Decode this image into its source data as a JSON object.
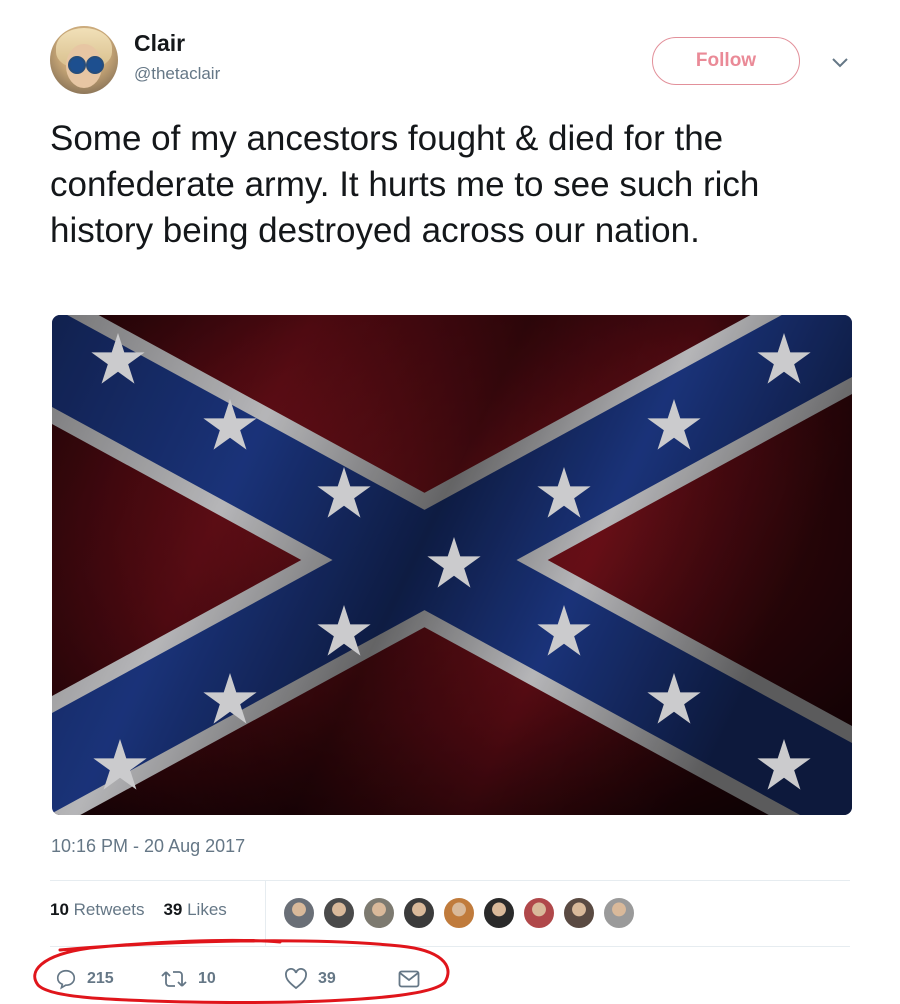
{
  "user": {
    "name": "Clair",
    "handle": "@thetaclair"
  },
  "follow_label": "Follow",
  "tweet_text": "Some of my ancestors fought & died for the confederate army. It hurts me to see such rich history being destroyed across our nation.",
  "timestamp": "10:16 PM - 20 Aug 2017",
  "stats": {
    "retweets_count": "10",
    "retweets_label": "Retweets",
    "likes_count": "39",
    "likes_label": "Likes"
  },
  "actions": {
    "replies": "215",
    "retweets": "10",
    "likes": "39"
  },
  "liker_avatar_colors": [
    "#6a6f77",
    "#4a4a4a",
    "#7d7a70",
    "#3b3b3b",
    "#c07b3c",
    "#2a2a2a",
    "#b0484a",
    "#5a4a42",
    "#9a9a9a"
  ],
  "colors": {
    "accent": "#e0245e",
    "follow": "#ea8a97",
    "muted": "#657786",
    "annotation": "#e0151b"
  }
}
